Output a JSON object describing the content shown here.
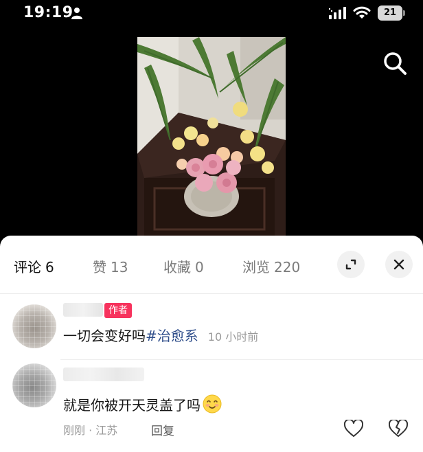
{
  "status_bar": {
    "time": "19:19",
    "battery": "21"
  },
  "icons": {
    "person": "person-icon",
    "signal": "signal-icon",
    "wifi": "wifi-icon",
    "search": "search-icon",
    "expand": "expand-icon",
    "close": "close-icon",
    "like": "heart-icon",
    "dislike": "broken-heart-icon",
    "emoji": "blushing-emoji-icon"
  },
  "tabs": [
    {
      "label": "评论",
      "count": "6",
      "active": true
    },
    {
      "label": "赞",
      "count": "13",
      "active": false
    },
    {
      "label": "收藏",
      "count": "0",
      "active": false
    },
    {
      "label": "浏览",
      "count": "220",
      "active": false
    }
  ],
  "comments": [
    {
      "badge": "作者",
      "text": "一切会变好吗",
      "hashtag": "#治愈系",
      "time": "10 小时前"
    },
    {
      "text": "就是你被开天灵盖了吗",
      "time": "刚刚",
      "location": "江苏",
      "meta_separator": "·",
      "reply_label": "回复"
    }
  ],
  "colors": {
    "background": "#000000",
    "sheet": "#ffffff",
    "author_badge": "#f7325d",
    "hashtag": "#2e4d8a",
    "muted_text": "#9a9a9a"
  }
}
